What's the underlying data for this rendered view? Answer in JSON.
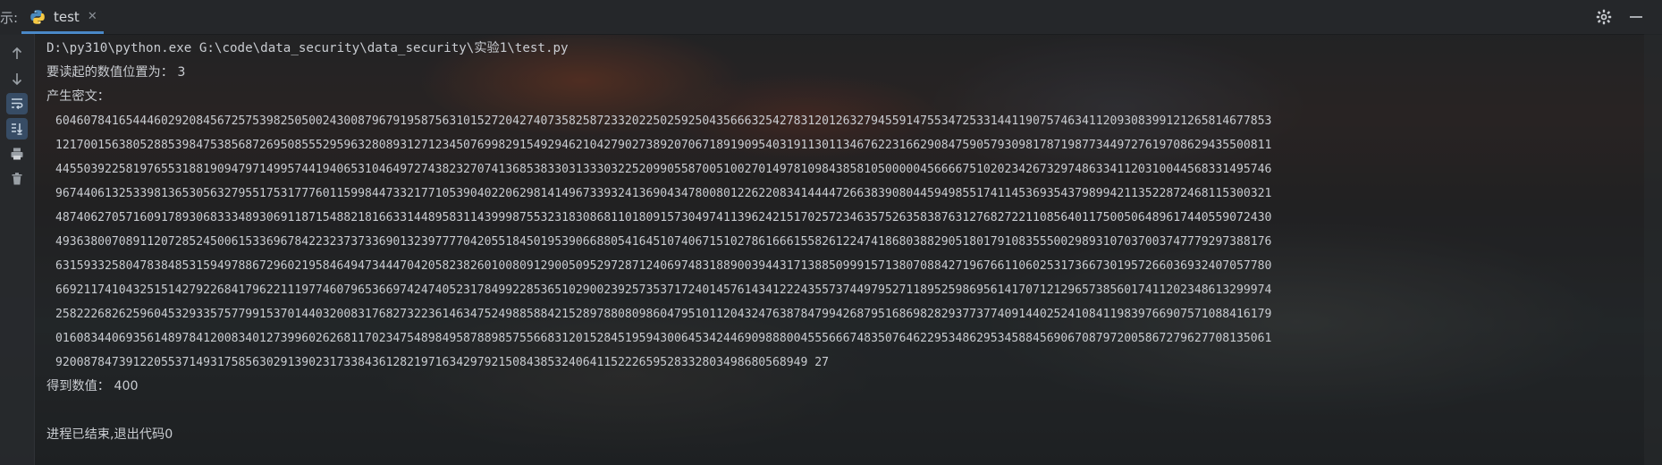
{
  "tabbar": {
    "prefix": "示:",
    "tab_label": "test"
  },
  "console": {
    "cmd": "D:\\py310\\python.exe G:\\code\\data_security\\data_security\\实验1\\test.py",
    "prompt": "要读起的数值位置为： 3",
    "key_label": "产生密文：",
    "key_lines": [
      "60460784165444602920845672575398250500243008796791958756310152720427407358258723320225025925043566632542783120126327945591475534725331441190757463411209308399121265814677853",
      "12170015638052885398475385687269508555295963280893127123450769982915492946210427902738920706718919095403191130113467622316629084759057930981787198773449727619708629435500811",
      "44550392258197655318819094797149957441940653104649727438232707413685383303133303225209905587005100270149781098438581050000045666675102023426732974863341120310044568331495746",
      "96744061325339813653056327955175317776011599844733217710539040220629814149673393241369043478008012262208341444472663839080445949855174114536935437989942113522872468115300321",
      "48740627057160917893068333489306911871548821816633144895831143999875532318308681101809157304974113962421517025723463575263583876312768272211085640117500506489617440559072430",
      "49363800708911207285245006153369678422323737336901323977770420551845019539066880541645107406715102786166615582612247418680388290518017910835550029893107037003747779297388176",
      "63159332580478384853159497886729602195846494734447042058238260100809129005095297287124069748318890039443171388509991571380708842719676611060253173667301957266036932407057780",
      "66921174104325151427922684179622111977460796536697424740523178499228536510290023925735371724014576143412224355737449795271189525986956141707121296573856017411202348613299974",
      "25822268262596045329335757799153701440320083176827322361463475249885884215289788080986047951011204324763878479942687951686982829377377409144025241084119839766907571088416179",
      "01608344069356148978412008340127399602626811702347548984958788985755668312015284519594300645342446909888004555666748350764622953486295345884569067087972005867279627708135061",
      "92008784739122055371493175856302913902317338436128219716342979215084385324064115222659528332803498680568949 27"
    ],
    "result": "得到数值： 400",
    "exit": "进程已结束,退出代码0"
  }
}
